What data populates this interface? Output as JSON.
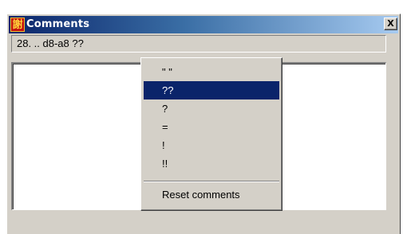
{
  "window": {
    "title": "Comments",
    "icon": "chinese-character-app-icon",
    "icon_glyph": "謝",
    "close_glyph": "X"
  },
  "move_field": {
    "value": "28. ..  d8-a8 ??"
  },
  "context_menu": {
    "items": [
      {
        "label": "\" \"",
        "selected": false
      },
      {
        "label": "??",
        "selected": true
      },
      {
        "label": "?",
        "selected": false
      },
      {
        "label": "=",
        "selected": false
      },
      {
        "label": "!",
        "selected": false
      },
      {
        "label": "!!",
        "selected": false
      }
    ],
    "reset_label": "Reset comments"
  },
  "colors": {
    "titlebar_start": "#0a246a",
    "titlebar_end": "#a6caf0",
    "selection": "#0a246a",
    "face": "#d4d0c8"
  }
}
